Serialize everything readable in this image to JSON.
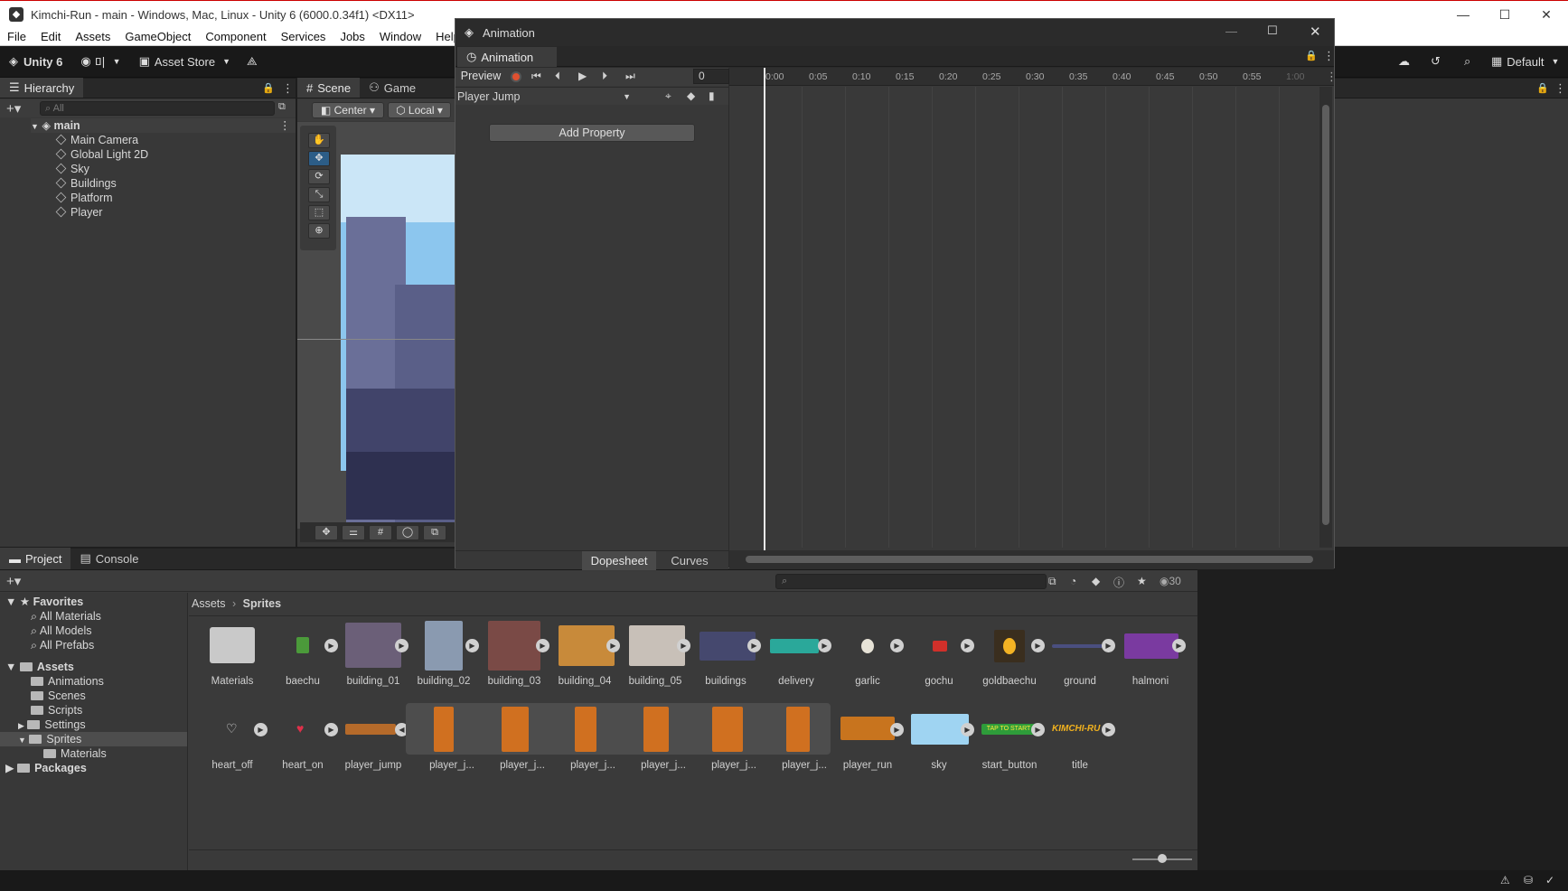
{
  "window": {
    "title": "Kimchi-Run - main - Windows, Mac, Linux - Unity 6 (6000.0.34f1) <DX11>"
  },
  "menu": [
    "File",
    "Edit",
    "Assets",
    "GameObject",
    "Component",
    "Services",
    "Jobs",
    "Window",
    "Help"
  ],
  "toolbar": {
    "unity_label": "Unity 6",
    "account_label": "미",
    "asset_store": "Asset Store",
    "layout": "Default"
  },
  "hierarchy": {
    "tab": "Hierarchy",
    "search_placeholder": "All",
    "scene": "main",
    "items": [
      "Main Camera",
      "Global Light 2D",
      "Sky",
      "Buildings",
      "Platform",
      "Player"
    ]
  },
  "scene_tabs": {
    "scene": "Scene",
    "game": "Game",
    "pivot": "Center",
    "space": "Local"
  },
  "animation": {
    "window_title": "Animation",
    "tab": "Animation",
    "preview": "Preview",
    "frame": "0",
    "clip": "Player Jump",
    "add_property": "Add Property",
    "bottom_tabs": [
      "Dopesheet",
      "Curves"
    ],
    "ruler": [
      "0:00",
      "0:05",
      "0:10",
      "0:15",
      "0:20",
      "0:25",
      "0:30",
      "0:35",
      "0:40",
      "0:45",
      "0:50",
      "0:55",
      "1:00"
    ]
  },
  "project": {
    "tabs": [
      "Project",
      "Console"
    ],
    "breadcrumb": [
      "Assets",
      "Sprites"
    ],
    "count": "30",
    "favorites": {
      "label": "Favorites",
      "items": [
        "All Materials",
        "All Models",
        "All Prefabs"
      ]
    },
    "assets": {
      "label": "Assets",
      "items": [
        "Animations",
        "Scenes",
        "Scripts",
        "Settings",
        "Sprites",
        "Materials"
      ]
    },
    "packages": "Packages",
    "row1": [
      "Materials",
      "baechu",
      "building_01",
      "building_02",
      "building_03",
      "building_04",
      "building_05",
      "buildings",
      "delivery",
      "garlic",
      "gochu",
      "goldbaechu",
      "ground",
      "halmoni"
    ],
    "row2": [
      "heart_off",
      "heart_on",
      "player_jump",
      "player_j...",
      "player_j...",
      "player_j...",
      "player_j...",
      "player_j...",
      "player_j...",
      "player_run",
      "sky",
      "start_button",
      "title"
    ],
    "thumb_text": {
      "start_button": "TAP TO START",
      "title": "KIMCHI-RU"
    }
  },
  "colors": {
    "accent": "#2c5d87",
    "record": "#e05030",
    "selected_sprite": "#4d4d4d"
  }
}
